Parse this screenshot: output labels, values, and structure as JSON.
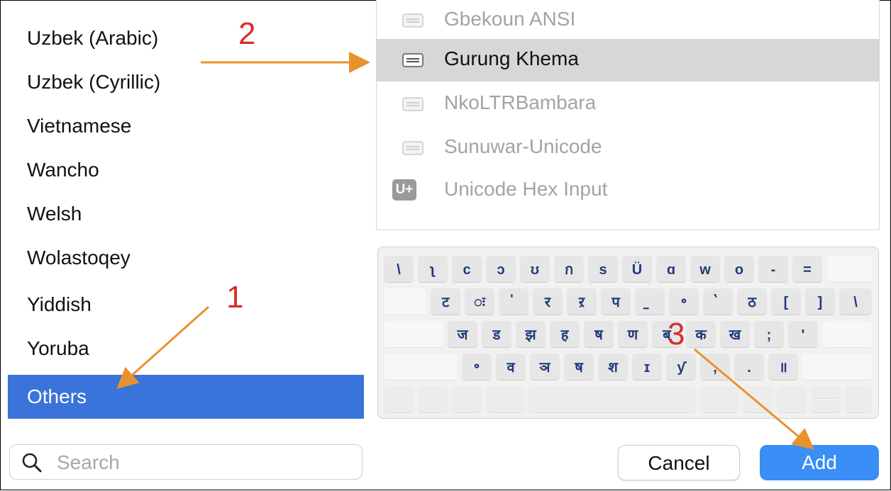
{
  "sidebar": {
    "languages": [
      {
        "label": "Uzbek (Arabic)",
        "selected": false
      },
      {
        "label": "Uzbek (Cyrillic)",
        "selected": false
      },
      {
        "label": "Vietnamese",
        "selected": false
      },
      {
        "label": "Wancho",
        "selected": false
      },
      {
        "label": "Welsh",
        "selected": false
      },
      {
        "label": "Wolastoqey",
        "selected": false
      },
      {
        "label": "Yiddish",
        "selected": false
      },
      {
        "label": "Yoruba",
        "selected": false
      },
      {
        "label": "Others",
        "selected": true
      }
    ],
    "search_placeholder": "Search"
  },
  "layouts": [
    {
      "label": "Gbekoun ANSI",
      "icon": "keyboard-icon",
      "selected": false
    },
    {
      "label": "Gurung Khema",
      "icon": "keyboard-icon",
      "selected": true
    },
    {
      "label": "NkoLTRBambara",
      "icon": "keyboard-icon",
      "selected": false
    },
    {
      "label": "Sunuwar-Unicode",
      "icon": "keyboard-icon",
      "selected": false
    },
    {
      "label": "Unicode Hex Input",
      "icon": "unicode-hex-icon",
      "icon_text": "U+",
      "selected": false
    }
  ],
  "keyboard": {
    "row1": [
      "\\",
      "ʅ",
      "c",
      "ɔ",
      "ʊ",
      "ก",
      "s",
      "Ü",
      "ɑ",
      "w",
      "o",
      "-",
      "="
    ],
    "row2": [
      "ट",
      "ः",
      "॑",
      "र",
      "ऱ",
      "प",
      "॒",
      "॰",
      "॓",
      "ठ",
      "[",
      "]",
      "\\"
    ],
    "row3": [
      "ज",
      "ड",
      "झ",
      "ह",
      "ष",
      "ण",
      "ब",
      "क",
      "ख",
      ";",
      "'"
    ],
    "row4": [
      "॰",
      "व",
      "ञ",
      "ष",
      "श",
      "ɪ",
      "ƴ",
      ",",
      ".",
      "॥"
    ]
  },
  "buttons": {
    "cancel": "Cancel",
    "add": "Add"
  },
  "annotations": {
    "one": "1",
    "two": "2",
    "three": "3"
  },
  "colors": {
    "selection": "#3a73d9",
    "add_button": "#3a8ef5",
    "annotation_number": "#d92b2b",
    "arrow": "#e8922e"
  }
}
